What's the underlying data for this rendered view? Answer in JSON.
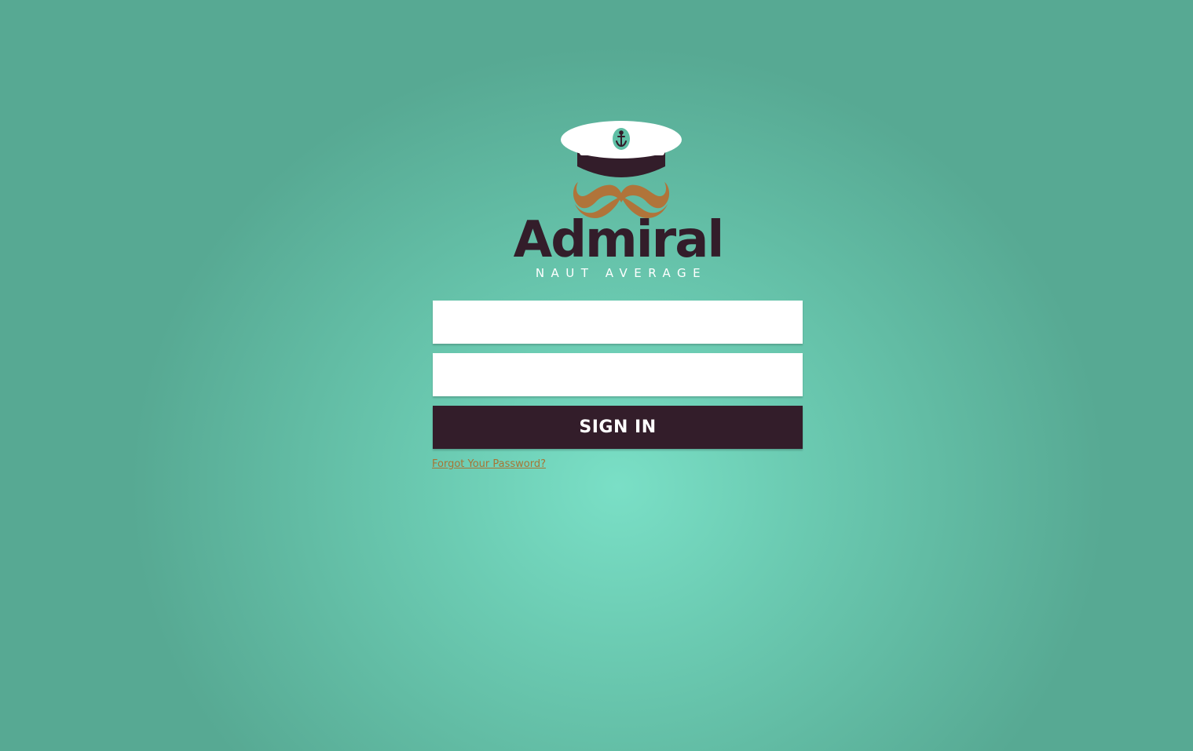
{
  "brand": {
    "name": "Admiral",
    "tagline": "NAUT AVERAGE",
    "colors": {
      "background": "#6cccb3",
      "dark": "#331d2a",
      "mustache": "#b0743a",
      "hat_white": "#ffffff"
    },
    "logo_icons": [
      "captain-hat-icon",
      "anchor-icon",
      "mustache-icon"
    ]
  },
  "login": {
    "username_value": "",
    "password_value": "",
    "sign_in_label": "SIGN IN",
    "forgot_password_label": "Forgot Your Password?"
  }
}
